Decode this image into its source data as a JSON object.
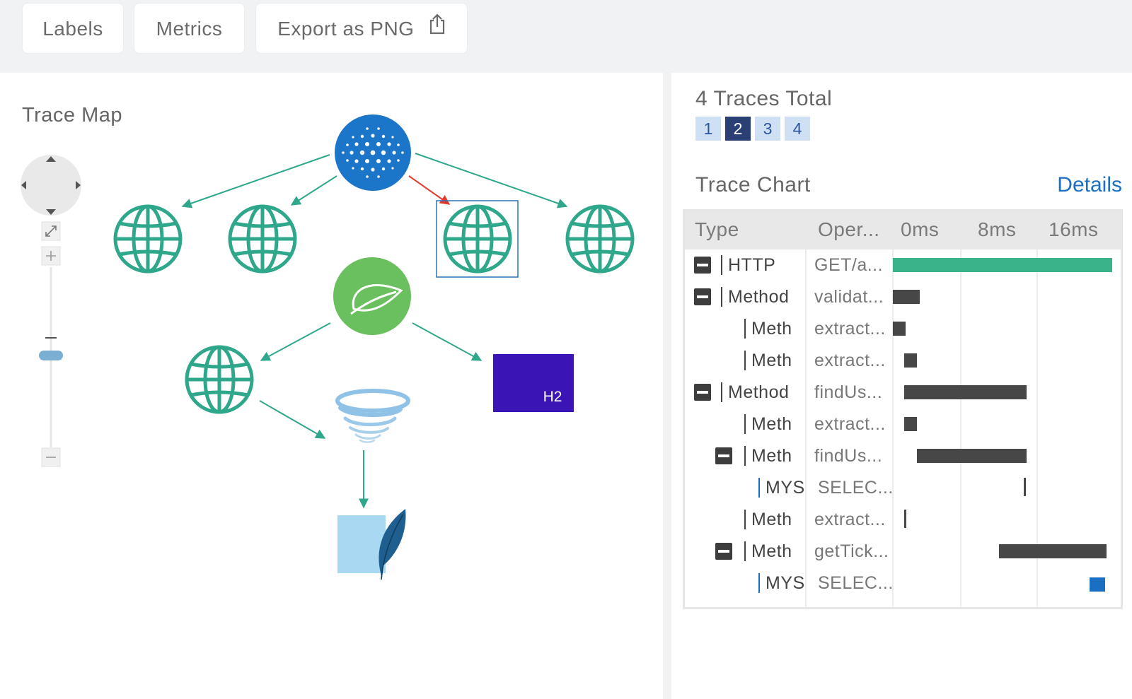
{
  "toolbar": {
    "labels_button": "Labels",
    "metrics_button": "Metrics",
    "export_button": "Export as PNG",
    "export_icon": "share-upload-icon"
  },
  "trace_map": {
    "title": "Trace Map",
    "nodes": [
      {
        "id": "root",
        "kind": "service-cluster",
        "icon": "cluster-dots-icon",
        "color": "#1b75c9"
      },
      {
        "id": "web1",
        "kind": "http-endpoint",
        "icon": "globe-icon",
        "color": "#2fa78a"
      },
      {
        "id": "web2",
        "kind": "http-endpoint",
        "icon": "globe-icon",
        "color": "#2fa78a"
      },
      {
        "id": "web3",
        "kind": "http-endpoint",
        "icon": "globe-icon",
        "color": "#2fa78a",
        "selected": true
      },
      {
        "id": "web4",
        "kind": "http-endpoint",
        "icon": "globe-icon",
        "color": "#2fa78a"
      },
      {
        "id": "spring",
        "kind": "spring-service",
        "icon": "leaf-icon",
        "color": "#6abf5e"
      },
      {
        "id": "web5",
        "kind": "http-endpoint",
        "icon": "globe-icon",
        "color": "#2fa78a"
      },
      {
        "id": "h2",
        "kind": "database",
        "label": "H2",
        "color": "#3a14b5"
      },
      {
        "id": "tornado",
        "kind": "queue",
        "icon": "tornado-icon",
        "color": "#8fc2e6"
      },
      {
        "id": "feather",
        "kind": "datastore",
        "icon": "feather-icon",
        "color": "#1e5f8f"
      }
    ]
  },
  "summary": {
    "traces_total": "4 Traces Total",
    "trace_tabs": [
      "1",
      "2",
      "3",
      "4"
    ],
    "active_tab": "2"
  },
  "trace_chart": {
    "title": "Trace Chart",
    "details_link": "Details",
    "headers": {
      "type": "Type",
      "operation": "Oper...",
      "t0": "0ms",
      "t1": "8ms",
      "t2": "16ms"
    },
    "colors": {
      "http": "#3bb38a",
      "method": "#474747",
      "mysql": "#1b6fc2"
    },
    "rows": [
      {
        "type": "HTTP",
        "operation": "GET/a...",
        "depth": 0,
        "collapsible": true,
        "start_ms": 0.0,
        "end_ms": 25.6,
        "kind": "http"
      },
      {
        "type": "Method",
        "operation": "validat...",
        "depth": 0,
        "collapsible": true,
        "start_ms": 0.0,
        "end_ms": 3.1,
        "kind": "method"
      },
      {
        "type": "Meth",
        "operation": "extract...",
        "depth": 1,
        "collapsible": false,
        "start_ms": 0.0,
        "end_ms": 1.5,
        "kind": "method"
      },
      {
        "type": "Meth",
        "operation": "extract...",
        "depth": 1,
        "collapsible": false,
        "start_ms": 1.3,
        "end_ms": 2.8,
        "kind": "method"
      },
      {
        "type": "Method",
        "operation": "findUs...",
        "depth": 0,
        "collapsible": true,
        "start_ms": 1.3,
        "end_ms": 15.6,
        "kind": "method"
      },
      {
        "type": "Meth",
        "operation": "extract...",
        "depth": 1,
        "collapsible": false,
        "start_ms": 1.3,
        "end_ms": 2.8,
        "kind": "method"
      },
      {
        "type": "Meth",
        "operation": "findUs...",
        "depth": 1,
        "collapsible": true,
        "start_ms": 2.8,
        "end_ms": 15.6,
        "kind": "method"
      },
      {
        "type": "MYS",
        "operation": "SELEC...",
        "depth": 2,
        "collapsible": false,
        "start_ms": 15.3,
        "end_ms": 15.6,
        "kind": "tick"
      },
      {
        "type": "Meth",
        "operation": "extract...",
        "depth": 1,
        "collapsible": false,
        "start_ms": 1.3,
        "end_ms": 1.6,
        "kind": "tick"
      },
      {
        "type": "Meth",
        "operation": "getTick...",
        "depth": 1,
        "collapsible": true,
        "start_ms": 12.4,
        "end_ms": 25.0,
        "kind": "method"
      },
      {
        "type": "MYS",
        "operation": "SELEC...",
        "depth": 2,
        "collapsible": false,
        "start_ms": 23.0,
        "end_ms": 24.8,
        "kind": "mysql"
      }
    ]
  }
}
